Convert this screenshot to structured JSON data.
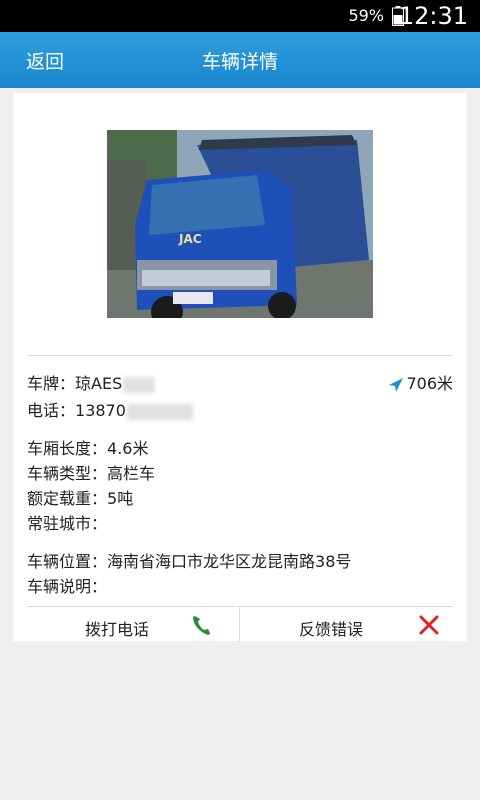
{
  "status_bar": {
    "battery": "59%",
    "time": "12:31"
  },
  "header": {
    "back_label": "返回",
    "title": "车辆详情"
  },
  "vehicle": {
    "photo_brand": "JAC",
    "plate_label": "车牌：",
    "plate_value": "琼AES",
    "phone_label": "电话：",
    "phone_value": "13870",
    "distance": "706米",
    "box_length_label": "车厢长度：",
    "box_length_value": "4.6米",
    "type_label": "车辆类型：",
    "type_value": "高栏车",
    "load_label": "额定载重：",
    "load_value": "5吨",
    "city_label": "常驻城市：",
    "city_value": "",
    "location_label": "车辆位置：",
    "location_value": "海南省海口市龙华区龙昆南路38号",
    "desc_label": "车辆说明：",
    "desc_value": ""
  },
  "actions": {
    "call_label": "拨打电话",
    "report_label": "反馈错误"
  },
  "colors": {
    "accent": "#1e90d8",
    "danger": "#e02020",
    "phone_green": "#2e8b3a"
  }
}
